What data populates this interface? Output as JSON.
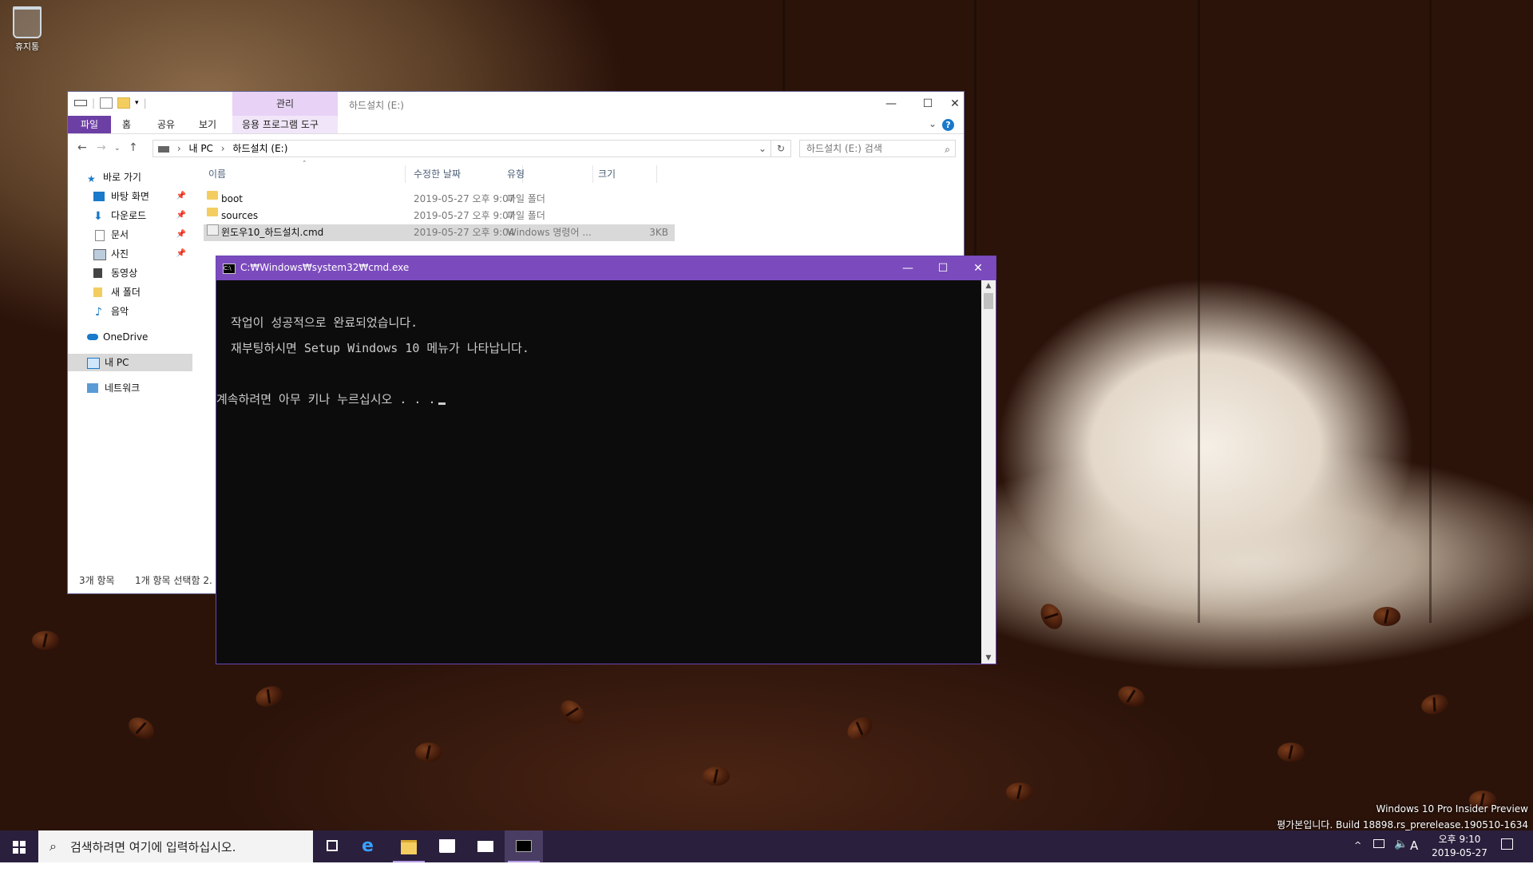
{
  "desktop": {
    "recycle_bin_label": "휴지통",
    "watermark_line1": "Windows 10 Pro Insider Preview",
    "watermark_line2": "평가본입니다. Build 18898.rs_prerelease.190510-1634"
  },
  "explorer": {
    "window_title": "하드설치 (E:)",
    "manage_tab_label": "관리",
    "ribbon_tabs": [
      "파일",
      "홈",
      "공유",
      "보기",
      "응용 프로그램 도구"
    ],
    "address_path": [
      "내 PC",
      "하드설치 (E:)"
    ],
    "search_placeholder": "하드설치 (E:) 검색",
    "nav": {
      "quick_access": "바로 가기",
      "items": [
        "바탕 화면",
        "다운로드",
        "문서",
        "사진",
        "동영상",
        "새 폴더",
        "음악"
      ],
      "onedrive": "OneDrive",
      "this_pc": "내 PC",
      "network": "네트워크"
    },
    "columns": [
      "이름",
      "수정한 날짜",
      "유형",
      "크기"
    ],
    "files": [
      {
        "name": "boot",
        "date": "2019-05-27 오후 9:07",
        "type": "파일 폴더",
        "size": ""
      },
      {
        "name": "sources",
        "date": "2019-05-27 오후 9:07",
        "type": "파일 폴더",
        "size": ""
      },
      {
        "name": "윈도우10_하드설치.cmd",
        "date": "2019-05-27 오후 9:04",
        "type": "Windows 명령어 ...",
        "size": "3KB"
      }
    ],
    "status_count": "3개 항목",
    "status_selected": "1개 항목 선택함 2."
  },
  "cmd": {
    "title": "C:₩Windows₩system32₩cmd.exe",
    "lines": [
      "  작업이 성공적으로 완료되었습니다.",
      "  재부팅하시면 Setup Windows 10 메뉴가 나타납니다.",
      "",
      "계속하려면 아무 키나 누르십시오 . . ."
    ]
  },
  "taskbar": {
    "search_placeholder": "검색하려면 여기에 입력하십시오.",
    "ime_indicator": "A",
    "time": "오후 9:10",
    "date": "2019-05-27"
  },
  "colors": {
    "explorer_accent": "#6c3fa5",
    "manage_tab": "#e8d2f5",
    "cmd_titlebar": "#7b4bbd",
    "taskbar": "#2a1f3d"
  }
}
